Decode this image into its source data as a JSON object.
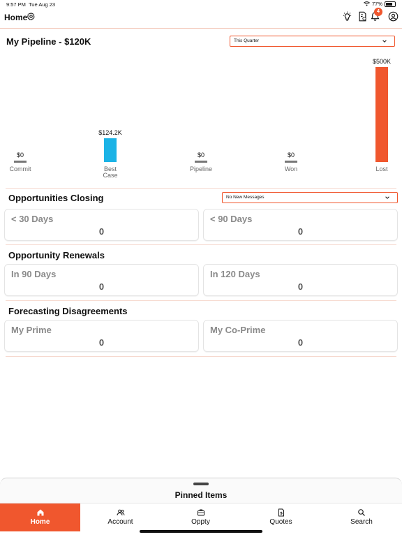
{
  "status_bar": {
    "time": "9:57 PM",
    "date": "Tue Aug 23",
    "battery": "77%"
  },
  "header": {
    "title": "Home",
    "notification_count": "4"
  },
  "pipeline": {
    "title": "My Pipeline - $120K",
    "period_dropdown": "This Quarter"
  },
  "chart_data": {
    "type": "bar",
    "categories": [
      "Commit",
      "Best Case",
      "Pipeline",
      "Won",
      "Lost"
    ],
    "values": [
      0,
      124.2,
      0,
      0,
      500
    ],
    "value_labels": [
      "$0",
      "$124.2K",
      "$0",
      "$0",
      "$500K"
    ],
    "units": "$K",
    "colors": [
      "#777777",
      "#1bb3e6",
      "#777777",
      "#777777",
      "#f0572e"
    ],
    "ylim": [
      0,
      500
    ],
    "grid": false,
    "legend": "none"
  },
  "opportunities_closing": {
    "title": "Opportunities Closing",
    "messages_dropdown": "No New Messages",
    "cards": [
      {
        "label": "< 30 Days",
        "value": "0"
      },
      {
        "label": "< 90 Days",
        "value": "0"
      }
    ]
  },
  "opportunity_renewals": {
    "title": "Opportunity Renewals",
    "cards": [
      {
        "label": "In 90 Days",
        "value": "0"
      },
      {
        "label": "In 120 Days",
        "value": "0"
      }
    ]
  },
  "forecasting": {
    "title": "Forecasting Disagreements",
    "cards": [
      {
        "label": "My Prime",
        "value": "0"
      },
      {
        "label": "My Co-Prime",
        "value": "0"
      }
    ]
  },
  "pinned": {
    "title": "Pinned Items"
  },
  "tabs": [
    {
      "label": "Home",
      "icon": "home-icon",
      "active": true
    },
    {
      "label": "Account",
      "icon": "people-icon",
      "active": false
    },
    {
      "label": "Oppty",
      "icon": "briefcase-icon",
      "active": false
    },
    {
      "label": "Quotes",
      "icon": "dollar-document-icon",
      "active": false
    },
    {
      "label": "Search",
      "icon": "search-icon",
      "active": false
    }
  ],
  "colors": {
    "accent": "#f0572e",
    "best_case": "#1bb3e6",
    "zero_bar": "#777777"
  }
}
